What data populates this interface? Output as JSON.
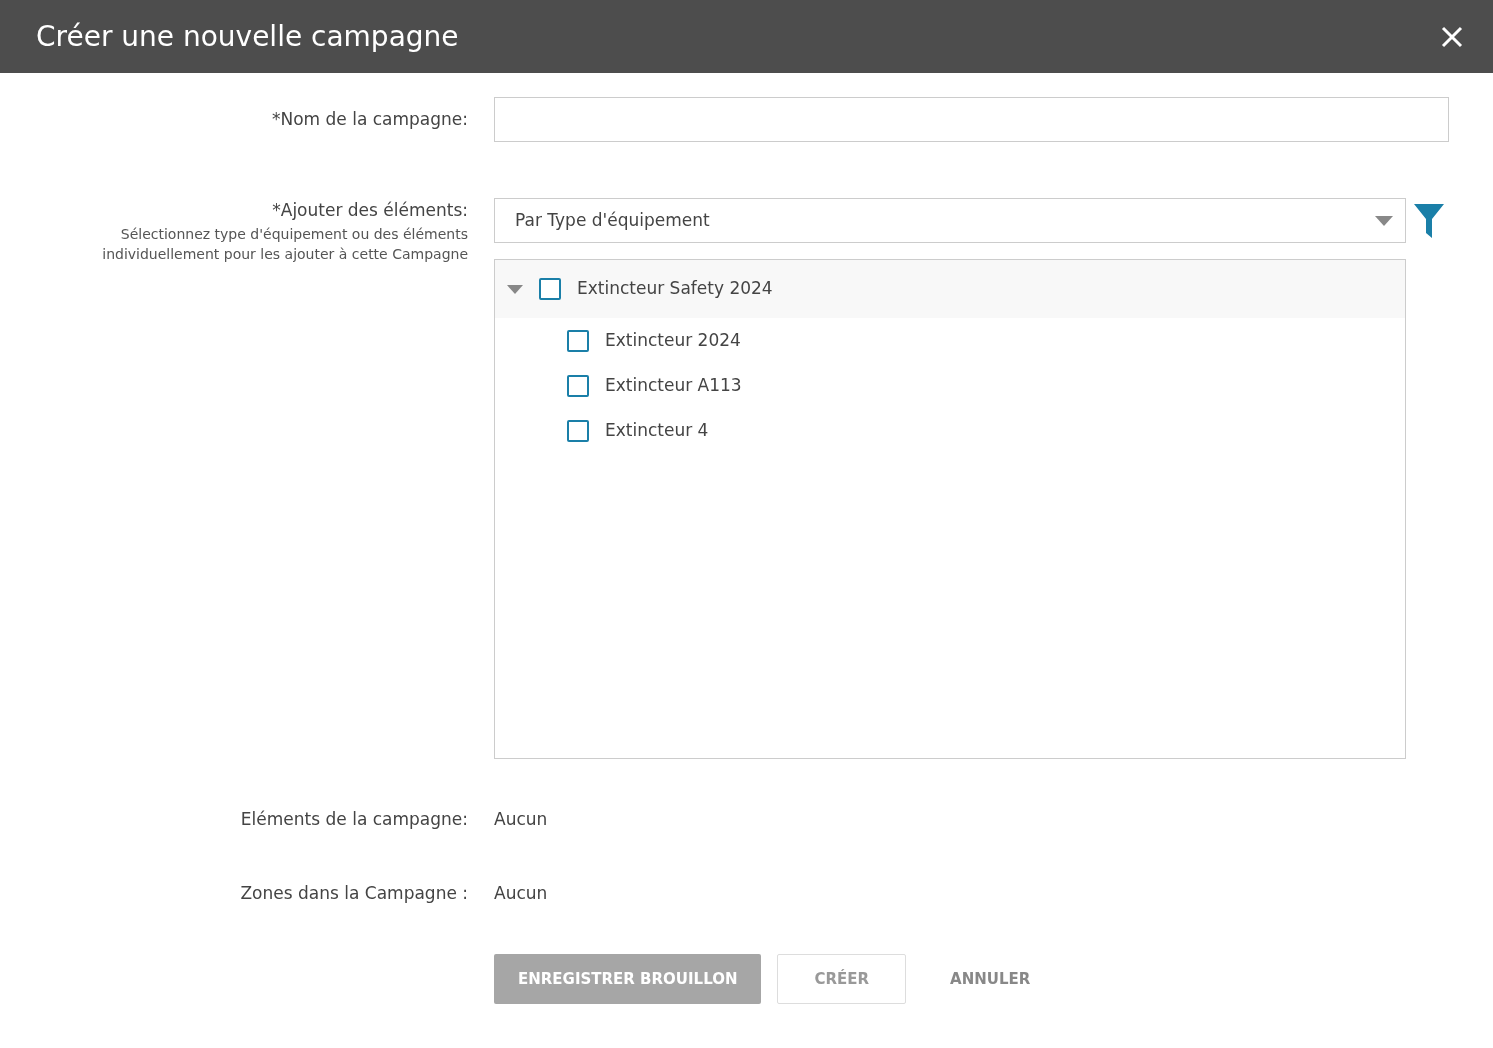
{
  "dialog": {
    "title": "Créer une nouvelle campagne"
  },
  "name_field": {
    "label": "*Nom de la campagne:"
  },
  "elements": {
    "label": "*Ajouter des éléments:",
    "hint": "Sélectionnez type d'équipement ou des éléments individuellement pour les ajouter à cette Campagne",
    "dropdown": {
      "value": "Par Type d'équipement"
    },
    "tree": [
      {
        "label": "Extincteur Safety 2024",
        "checked": false,
        "expanded": true,
        "children": [
          {
            "label": "Extincteur 2024",
            "checked": false
          },
          {
            "label": "Extincteur A113",
            "checked": false
          },
          {
            "label": "Extincteur 4",
            "checked": false
          }
        ]
      }
    ]
  },
  "summary": [
    {
      "label": "Eléments de la campagne:",
      "value": "Aucun"
    },
    {
      "label": "Zones dans la Campagne :",
      "value": "Aucun"
    }
  ],
  "buttons": [
    {
      "label": "ENREGISTRER BROUILLON",
      "kind": "primary",
      "disabled": true
    },
    {
      "label": "CRÉER",
      "kind": "outline",
      "disabled": true
    },
    {
      "label": "ANNULER",
      "kind": "text",
      "disabled": false
    }
  ]
}
